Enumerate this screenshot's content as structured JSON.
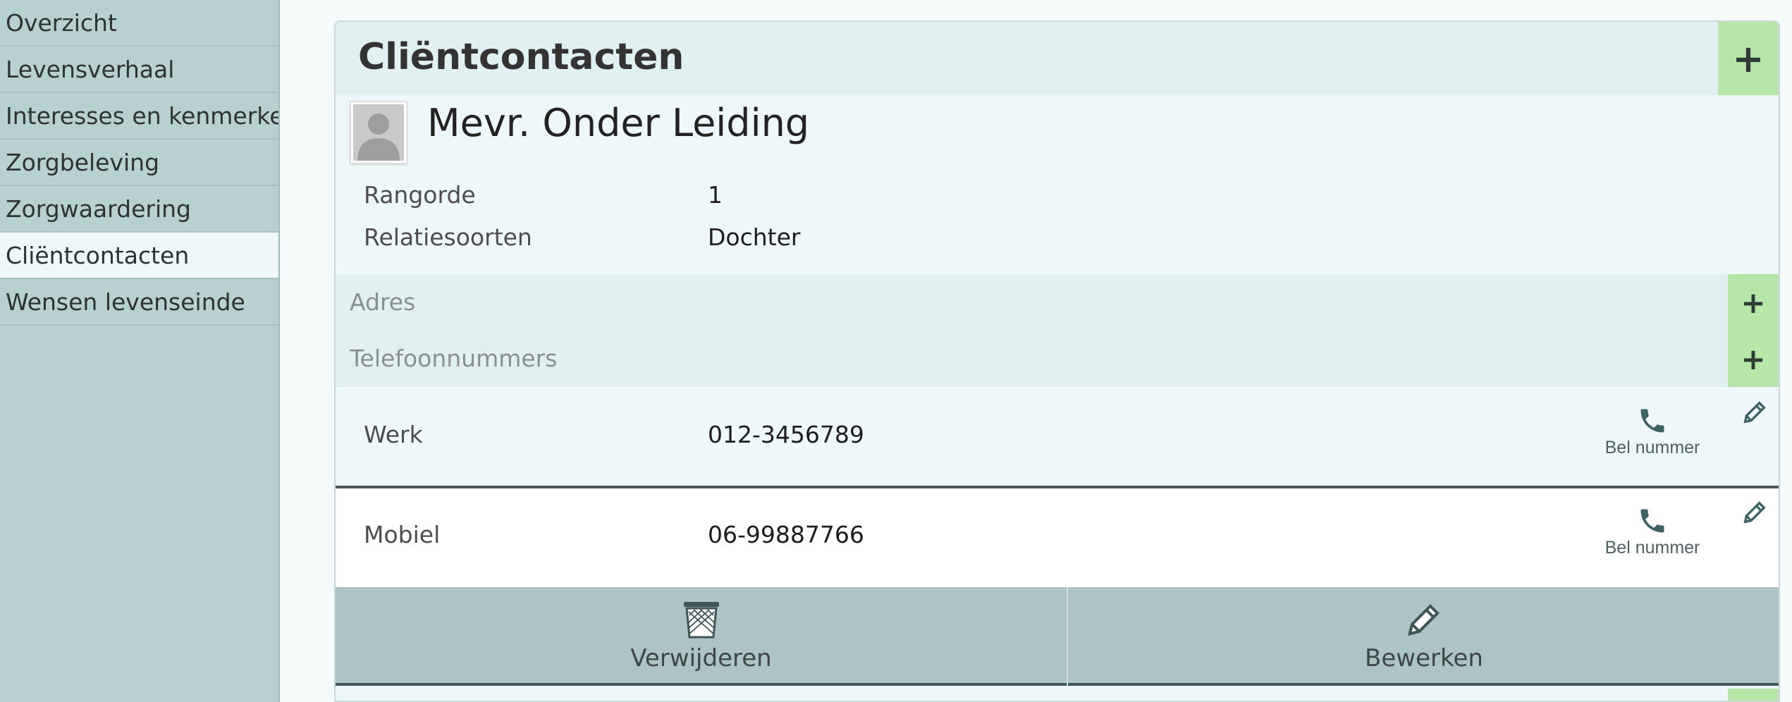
{
  "sidebar": {
    "items": [
      {
        "label": "Overzicht"
      },
      {
        "label": "Levensverhaal"
      },
      {
        "label": "Interesses en kenmerken"
      },
      {
        "label": "Zorgbeleving"
      },
      {
        "label": "Zorgwaardering"
      },
      {
        "label": "Cliëntcontacten",
        "active": true
      },
      {
        "label": "Wensen levenseinde"
      }
    ]
  },
  "panel": {
    "title": "Cliëntcontacten",
    "add_icon": "plus-icon",
    "contact": {
      "name": "Mevr. Onder Leiding",
      "avatar_icon": "person-silhouette-icon",
      "fields": [
        {
          "label": "Rangorde",
          "value": "1"
        },
        {
          "label": "Relatiesoorten",
          "value": "Dochter"
        }
      ]
    },
    "sections": {
      "address": {
        "label": "Adres"
      },
      "phones": {
        "label": "Telefoonnummers"
      }
    },
    "phone_numbers": [
      {
        "type": "Werk",
        "number": "012-3456789",
        "call_label": "Bel nummer"
      },
      {
        "type": "Mobiel",
        "number": "06-99887766",
        "call_label": "Bel nummer"
      }
    ],
    "actions": {
      "delete_label": "Verwijderen",
      "edit_label": "Bewerken"
    }
  },
  "colors": {
    "sidebar_bg": "#b7d1d1",
    "active_item_bg": "#eef7f9",
    "header_bg": "#e1f0f0",
    "add_button_green": "#b8e6a8",
    "action_bar_bg": "#adc4c6",
    "icon_teal": "#3f6262"
  }
}
